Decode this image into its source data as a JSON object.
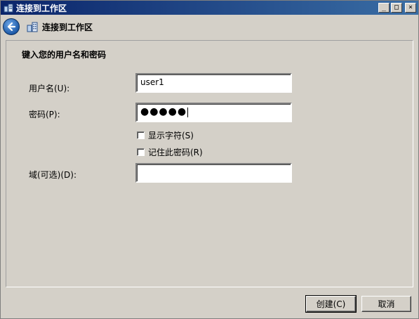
{
  "window": {
    "title": "连接到工作区",
    "controls": {
      "minimize": "_",
      "maximize": "□",
      "close": "×"
    }
  },
  "nav": {
    "title": "连接到工作区",
    "back_icon": "back-arrow-icon",
    "page_icon": "workplace-network-icon"
  },
  "form": {
    "heading": "键入您的用户名和密码",
    "username_label": "用户名(U):",
    "username_value": "user1",
    "password_label": "密码(P):",
    "password_value": "●●●●●",
    "show_chars_label": "显示字符(S)",
    "show_chars_checked": false,
    "remember_label": "记住此密码(R)",
    "remember_checked": false,
    "domain_label": "域(可选)(D):",
    "domain_value": ""
  },
  "footer": {
    "create_label": "创建(C)",
    "cancel_label": "取消"
  },
  "colors": {
    "titlebar_start": "#0a246a",
    "titlebar_end": "#3a6ea5",
    "background": "#d4d0c8",
    "back_button": "#1d5aa8"
  }
}
